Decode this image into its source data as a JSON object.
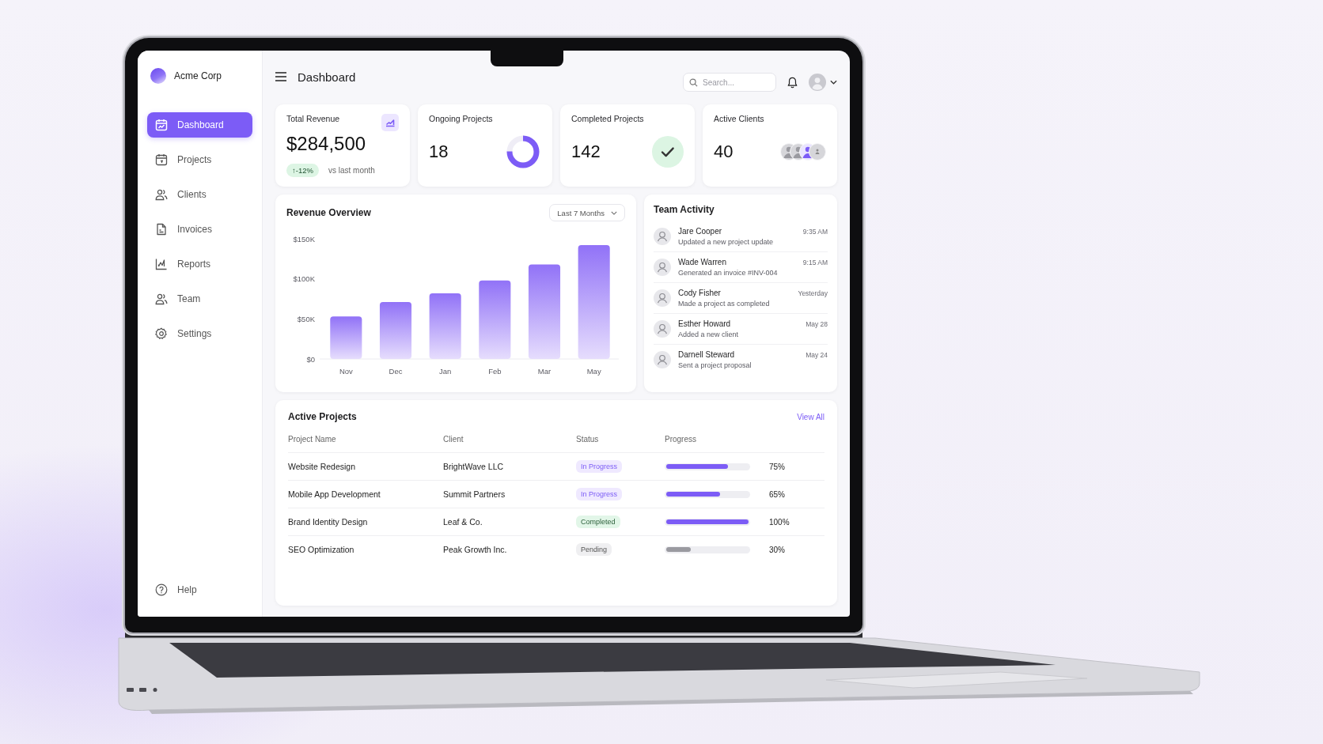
{
  "sidebar": {
    "brand": "Acme Corp",
    "items": [
      {
        "label": "Dashboard",
        "selected": true
      },
      {
        "label": "Projects",
        "selected": false
      },
      {
        "label": "Clients",
        "selected": false
      },
      {
        "label": "Invoices",
        "selected": false
      },
      {
        "label": "Reports",
        "selected": false
      },
      {
        "label": "Team",
        "selected": false
      },
      {
        "label": "Settings",
        "selected": false
      }
    ],
    "help": "Help"
  },
  "header": {
    "title": "Dashboard",
    "search": {
      "placeholder": "Search..."
    }
  },
  "stats": [
    {
      "kind": "trend",
      "label": "Total Revenue",
      "value": "$284,500",
      "change": "↑-12%",
      "note": "vs last month"
    },
    {
      "kind": "ring",
      "label": "Ongoing Projects",
      "value": "18",
      "level": 0.75
    },
    {
      "kind": "check",
      "label": "Completed Projects",
      "value": "142"
    },
    {
      "kind": "avatars",
      "label": "Active Clients",
      "value": "40"
    }
  ],
  "revenue": {
    "range": "Last 7 Months",
    "chart_data": {
      "type": "bar",
      "title": "Revenue Overview",
      "categories": [
        "Nov",
        "Dec",
        "Jan",
        "Feb",
        "Mar",
        "May"
      ],
      "values": [
        53000,
        71000,
        82000,
        98000,
        118000,
        142000
      ],
      "ylim": [
        0,
        150000
      ],
      "yticks": [
        {
          "value": 0,
          "label": "$0"
        },
        {
          "value": 50000,
          "label": "$50K"
        },
        {
          "value": 100000,
          "label": "$100K"
        },
        {
          "value": 150000,
          "label": "$150K"
        }
      ]
    }
  },
  "activity": {
    "title": "Team Activity",
    "items": [
      {
        "name": "Jare Cooper",
        "action": "Updated a new project update",
        "time": "9:35 AM"
      },
      {
        "name": "Wade Warren",
        "action": "Generated an invoice #INV-004",
        "time": "9:15 AM"
      },
      {
        "name": "Cody Fisher",
        "action": "Made a project as completed",
        "time": "Yesterday"
      },
      {
        "name": "Esther Howard",
        "action": "Added a new client",
        "time": "May 28"
      },
      {
        "name": "Darnell Steward",
        "action": "Sent a project proposal",
        "time": "May 24"
      }
    ]
  },
  "projects": {
    "title": "Active Projects",
    "view_all": "View All",
    "columns": [
      "Project Name",
      "Client",
      "Status",
      "Progress"
    ],
    "rows": [
      {
        "name": "Website Redesign",
        "client": "BrightWave LLC",
        "status": {
          "label": "In Progress",
          "kind": "progress"
        },
        "level": 0.75,
        "percent": "75%"
      },
      {
        "name": "Mobile App Development",
        "client": "Summit Partners",
        "status": {
          "label": "In Progress",
          "kind": "progress"
        },
        "level": 0.65,
        "percent": "65%"
      },
      {
        "name": "Brand Identity Design",
        "client": "Leaf & Co.",
        "status": {
          "label": "Completed",
          "kind": "done"
        },
        "level": 1.0,
        "percent": "100%"
      },
      {
        "name": "SEO Optimization",
        "client": "Peak Growth Inc.",
        "status": {
          "label": "Pending",
          "kind": "pending"
        },
        "level": 0.3,
        "percent": "30%"
      }
    ]
  }
}
